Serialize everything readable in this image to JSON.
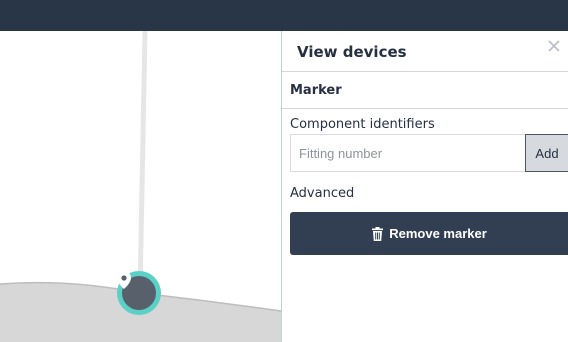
{
  "panel": {
    "title": "View devices",
    "section_title": "Marker",
    "component_label": "Component identifiers",
    "fitting_placeholder": "Fitting number",
    "fitting_value": "",
    "add_label": "Add",
    "advanced_label": "Advanced",
    "remove_label": "Remove marker"
  },
  "icons": {
    "close": "close-icon",
    "trash": "trash-icon",
    "location_pin": "location-pin-icon"
  },
  "colors": {
    "topbar": "#283648",
    "marker_ring": "#5ad0c7",
    "marker_fill": "#58606b",
    "remove_button": "#323f53"
  }
}
